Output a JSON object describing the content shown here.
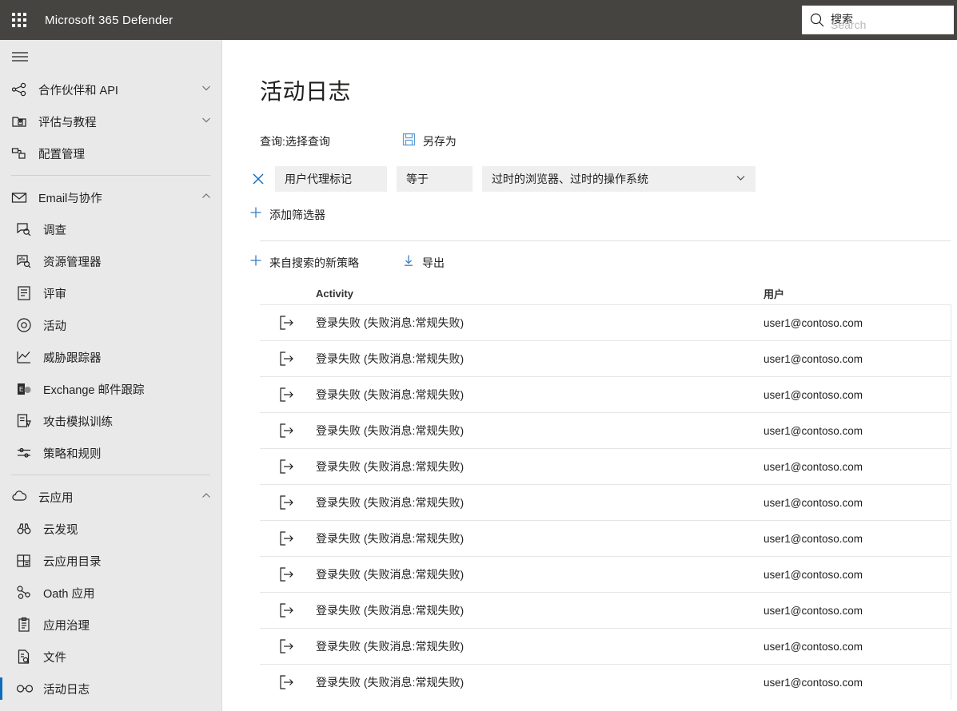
{
  "topbar": {
    "waffle_icon": "waffle-grid-icon",
    "app_title": "Microsoft 365 Defender",
    "search": {
      "icon": "search-icon",
      "placeholder_cn": "搜索",
      "placeholder_en": "Search",
      "value": ""
    }
  },
  "sidebar": {
    "hamburger_icon": "hamburger-icon",
    "groups": [
      {
        "items": [
          {
            "label": "合作伙伴和 API",
            "icon": "partners-api-icon",
            "chevron": "chevron-down-icon",
            "child": false,
            "selected": false
          },
          {
            "label": "评估与教程",
            "icon": "evaluation-tutorial-icon",
            "chevron": "chevron-down-icon",
            "child": false,
            "selected": false
          },
          {
            "label": "配置管理",
            "icon": "configuration-management-icon",
            "chevron": "",
            "child": false,
            "selected": false
          }
        ]
      },
      {
        "items": [
          {
            "label": "Email与协作",
            "icon": "mail-icon",
            "chevron": "chevron-up-icon",
            "child": false,
            "selected": false
          },
          {
            "label": "调查",
            "icon": "investigation-icon",
            "chevron": "",
            "child": true,
            "selected": false
          },
          {
            "label": "资源管理器",
            "icon": "explorer-icon",
            "chevron": "",
            "child": true,
            "selected": false
          },
          {
            "label": "评审",
            "icon": "review-icon",
            "chevron": "",
            "child": true,
            "selected": false
          },
          {
            "label": "活动",
            "icon": "campaign-icon",
            "chevron": "",
            "child": true,
            "selected": false
          },
          {
            "label": "威胁跟踪器",
            "icon": "threat-tracker-icon",
            "chevron": "",
            "child": true,
            "selected": false
          },
          {
            "label": "Exchange 邮件跟踪",
            "icon": "exchange-icon",
            "chevron": "",
            "child": true,
            "selected": false
          },
          {
            "label": "攻击模拟训练",
            "icon": "attack-simulation-icon",
            "chevron": "",
            "child": true,
            "selected": false
          },
          {
            "label": "策略和规则",
            "icon": "policies-rules-icon",
            "chevron": "",
            "child": true,
            "selected": false
          }
        ]
      },
      {
        "items": [
          {
            "label": "云应用",
            "icon": "cloud-icon",
            "chevron": "chevron-up-icon",
            "child": false,
            "selected": false
          },
          {
            "label": "云发现",
            "icon": "binoculars-icon",
            "chevron": "",
            "child": true,
            "selected": false
          },
          {
            "label": "云应用目录",
            "icon": "catalog-grid-icon",
            "chevron": "",
            "child": true,
            "selected": false
          },
          {
            "label": "Oath 应用",
            "icon": "oauth-apps-icon",
            "chevron": "",
            "child": true,
            "selected": false
          },
          {
            "label": "应用治理",
            "icon": "app-governance-clipboard-icon",
            "chevron": "",
            "child": true,
            "selected": false
          },
          {
            "label": "文件",
            "icon": "files-icon",
            "chevron": "",
            "child": true,
            "selected": false
          },
          {
            "label": "活动日志",
            "icon": "activity-log-glasses-icon",
            "chevron": "",
            "child": true,
            "selected": true
          }
        ]
      }
    ]
  },
  "main": {
    "page_title": "活动日志",
    "query": {
      "label": "查询:选择查询",
      "save_as_icon": "save-floppy-icon",
      "save_as_label": "另存为"
    },
    "filter": {
      "remove_icon": "close-x-icon",
      "field": "用户代理标记",
      "operator": "等于",
      "value": "过时的浏览器、过时的操作系统",
      "value_chevron": "chevron-down-icon",
      "add_icon": "plus-icon",
      "add_label": "添加筛选器"
    },
    "toolbar": {
      "new_policy_icon": "plus-icon",
      "new_policy_label": "来自搜索的新策略",
      "export_icon": "download-arrow-icon",
      "export_label": "导出"
    },
    "table": {
      "columns": [
        "Activity",
        "用户"
      ],
      "row_icon": "sign-in-failure-arrow-icon",
      "rows": [
        {
          "activity": "登录失败 (失败消息:常规失败)",
          "user": "user1@contoso.com"
        },
        {
          "activity": "登录失败 (失败消息:常规失败)",
          "user": "user1@contoso.com"
        },
        {
          "activity": "登录失败 (失败消息:常规失败)",
          "user": "user1@contoso.com"
        },
        {
          "activity": "登录失败 (失败消息:常规失败)",
          "user": "user1@contoso.com"
        },
        {
          "activity": "登录失败 (失败消息:常规失败)",
          "user": "user1@contoso.com"
        },
        {
          "activity": "登录失败 (失败消息:常规失败)",
          "user": "user1@contoso.com"
        },
        {
          "activity": "登录失败 (失败消息:常规失败)",
          "user": "user1@contoso.com"
        },
        {
          "activity": "登录失败 (失败消息:常规失败)",
          "user": "user1@contoso.com"
        },
        {
          "activity": "登录失败 (失败消息:常规失败)",
          "user": "user1@contoso.com"
        },
        {
          "activity": "登录失败 (失败消息:常规失败)",
          "user": "user1@contoso.com"
        },
        {
          "activity": "登录失败 (失败消息:常规失败)",
          "user": "user1@contoso.com"
        }
      ]
    }
  },
  "colors": {
    "topbar_bg": "#464441",
    "sidebar_bg": "#e9e9e9",
    "accent_blue": "#0f6cbd",
    "filter_box_bg": "#efefef",
    "row_border": "#e6e6e6"
  }
}
